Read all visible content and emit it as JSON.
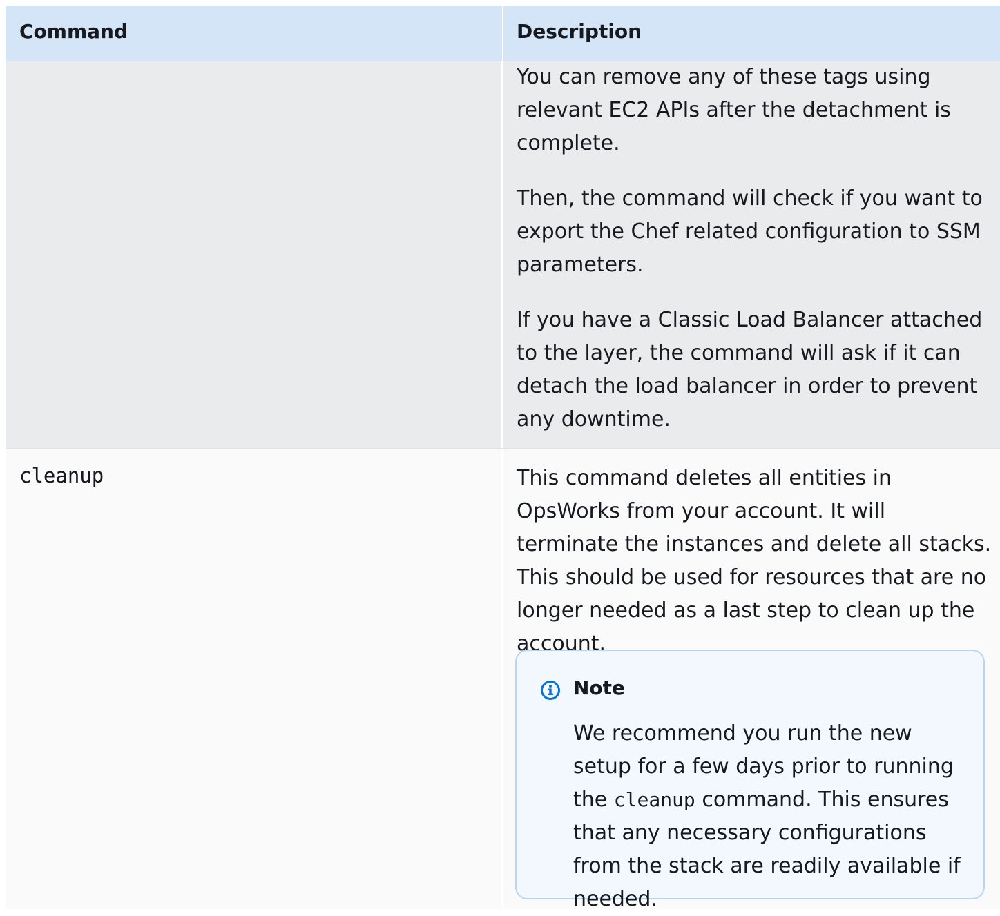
{
  "table": {
    "headers": {
      "command": "Command",
      "description": "Description"
    },
    "rows": [
      {
        "command": "",
        "paragraphs": [
          "You can remove any of these tags using relevant EC2 APIs after the detachment is complete.",
          "Then, the command will check if you want to export the Chef related configuration to SSM parameters.",
          "If you have a Classic Load Balancer attached to the layer, the command will ask if it can detach the load balancer in order to prevent any downtime."
        ]
      },
      {
        "command": "cleanup",
        "paragraphs": [
          "This command deletes all entities in OpsWorks from your account. It will terminate the instances and delete all stacks. This should be used for resources that are no longer needed as a last step to clean up the account."
        ],
        "note": {
          "icon": "info-icon",
          "title": "Note",
          "text_before": "We recommend you run the new setup for a few days prior to running the ",
          "code": "cleanup",
          "text_after": " command. This ensures that any necessary configurations from the stack are readily available if needed."
        }
      }
    ]
  },
  "colors": {
    "header_bg": "#d3e5f6",
    "row_shaded_bg": "#eaebec",
    "row_plain_bg": "#fafafa",
    "note_border": "#b8d6f0",
    "note_bg": "#f2f8fd",
    "info_icon": "#0972d3",
    "text": "#16191f"
  }
}
